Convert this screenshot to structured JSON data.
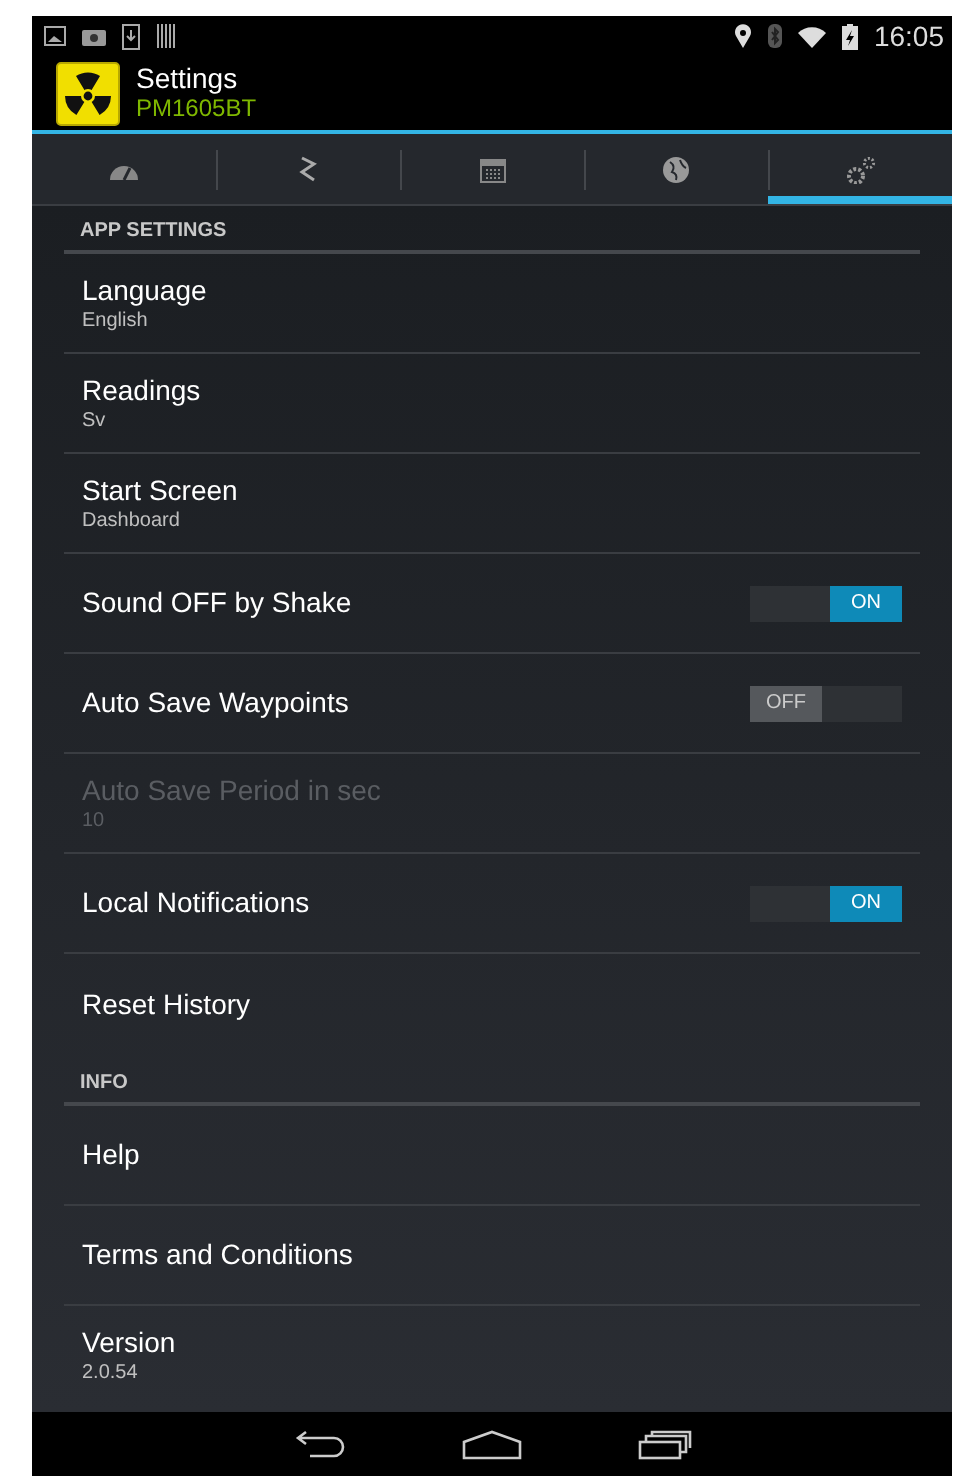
{
  "status_bar": {
    "time": "16:05"
  },
  "action_bar": {
    "title": "Settings",
    "subtitle": "PM1605BT"
  },
  "tabs": [
    {
      "kind": "gauge",
      "selected": false
    },
    {
      "kind": "zigzag",
      "selected": false
    },
    {
      "kind": "calendar",
      "selected": false
    },
    {
      "kind": "globe",
      "selected": false
    },
    {
      "kind": "gears",
      "selected": true
    }
  ],
  "sections": [
    {
      "header": "APP SETTINGS",
      "items": [
        {
          "kind": "pref",
          "title": "Language",
          "summary": "English",
          "disabled": false
        },
        {
          "kind": "pref",
          "title": "Readings",
          "summary": "Sv",
          "disabled": false
        },
        {
          "kind": "pref",
          "title": "Start Screen",
          "summary": "Dashboard",
          "disabled": false
        },
        {
          "kind": "toggle",
          "title": "Sound OFF by Shake",
          "on": true,
          "switch_label": "ON"
        },
        {
          "kind": "toggle",
          "title": "Auto Save Waypoints",
          "on": false,
          "switch_label": "OFF"
        },
        {
          "kind": "pref",
          "title": "Auto Save Period in sec",
          "summary": "10",
          "disabled": true
        },
        {
          "kind": "toggle",
          "title": "Local Notifications",
          "on": true,
          "switch_label": "ON"
        },
        {
          "kind": "pref",
          "title": "Reset History",
          "disabled": false
        }
      ]
    },
    {
      "header": "INFO",
      "items": [
        {
          "kind": "pref",
          "title": "Help",
          "disabled": false
        },
        {
          "kind": "pref",
          "title": "Terms and Conditions",
          "disabled": false
        },
        {
          "kind": "pref",
          "title": "Version",
          "summary": "2.0.54",
          "disabled": false
        }
      ]
    }
  ]
}
